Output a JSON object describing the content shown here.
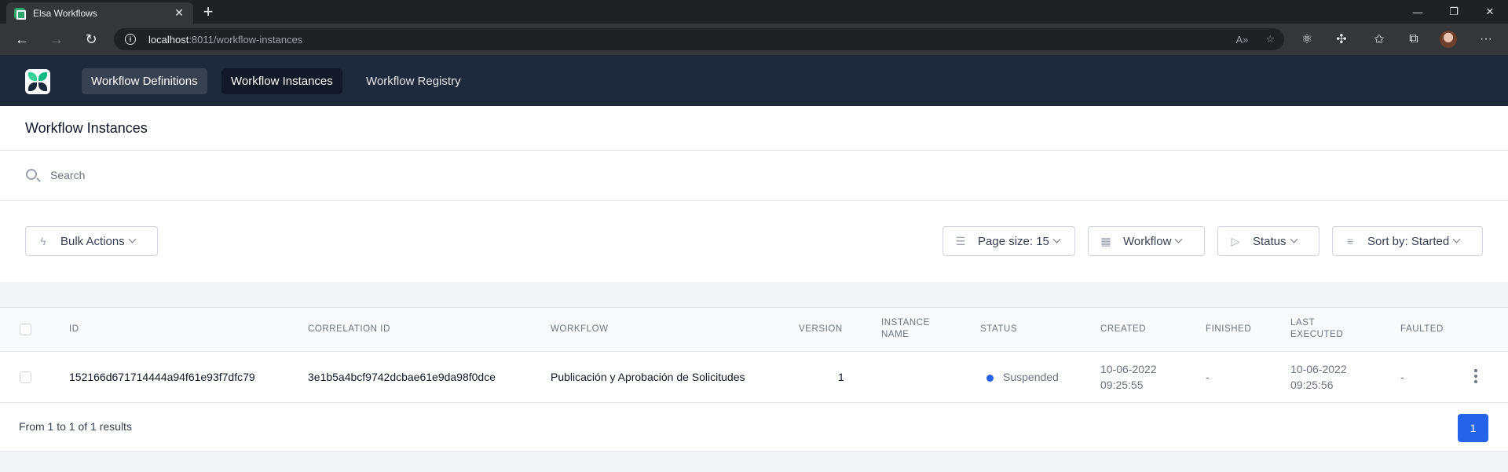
{
  "browser": {
    "tab_title": "Elsa Workflows",
    "tab_close": "✕",
    "new_tab": "+",
    "url_host": "localhost",
    "url_rest": ":8011/workflow-instances"
  },
  "nav": {
    "items": [
      {
        "label": "Workflow Definitions"
      },
      {
        "label": "Workflow Instances"
      },
      {
        "label": "Workflow Registry"
      }
    ]
  },
  "page": {
    "title": "Workflow Instances"
  },
  "search": {
    "placeholder": "Search"
  },
  "filters": {
    "bulk_actions": "Bulk Actions",
    "page_size": "Page size: 15",
    "workflow": "Workflow",
    "status": "Status",
    "sort_by": "Sort by: Started"
  },
  "table": {
    "headers": {
      "id": "ID",
      "correlation_id": "CORRELATION ID",
      "workflow": "WORKFLOW",
      "version": "VERSION",
      "instance_name_1": "INSTANCE",
      "instance_name_2": "NAME",
      "status": "STATUS",
      "created": "CREATED",
      "finished": "FINISHED",
      "last_executed_1": "LAST",
      "last_executed_2": "EXECUTED",
      "faulted": "FAULTED"
    },
    "rows": [
      {
        "id": "152166d671714444a94f61e93f7dfc79",
        "correlation_id": "3e1b5a4bcf9742dcbae61e9da98f0dce",
        "workflow": "Publicación y Aprobación de Solicitudes",
        "version": "1",
        "instance_name": "",
        "status": "Suspended",
        "status_color": "#2563eb",
        "created_date": "10-06-2022",
        "created_time": "09:25:55",
        "finished": "-",
        "last_executed_date": "10-06-2022",
        "last_executed_time": "09:25:56",
        "faulted": "-"
      }
    ]
  },
  "pagination": {
    "results_text": "From 1 to 1 of 1 results",
    "current_page": "1"
  },
  "colors": {
    "header_bg": "#1e293b",
    "accent": "#2563eb"
  }
}
